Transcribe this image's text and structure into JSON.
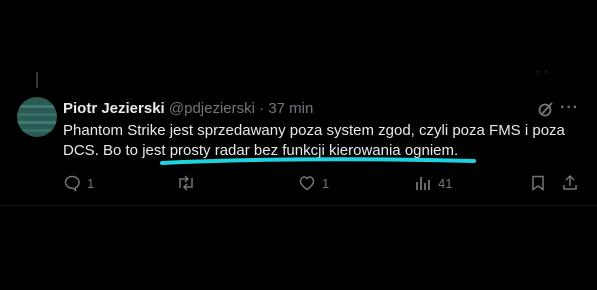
{
  "tweet": {
    "author_name": "Piotr Jezierski",
    "handle": "@pdjezierski",
    "separator": "·",
    "time": "37 min",
    "text_line1": "Phantom Strike jest sprzedawany poza system zgod, czyli poza FMS i poza",
    "text_line2": "DCS. Bo to jest prosty radar bez funkcji kierowania ogniem."
  },
  "actions": {
    "reply_count": "1",
    "retweet_count": "",
    "like_count": "1",
    "views_count": "41"
  },
  "colors": {
    "background": "#000000",
    "text": "#e7e9ea",
    "muted": "#71767b",
    "annotation": "#1dd3e0"
  },
  "icons": {
    "reply": "reply-icon",
    "retweet": "retweet-icon",
    "like": "heart-icon",
    "views": "views-icon",
    "bookmark": "bookmark-icon",
    "share": "share-icon",
    "grok": "grok-icon",
    "more": "more-icon"
  }
}
